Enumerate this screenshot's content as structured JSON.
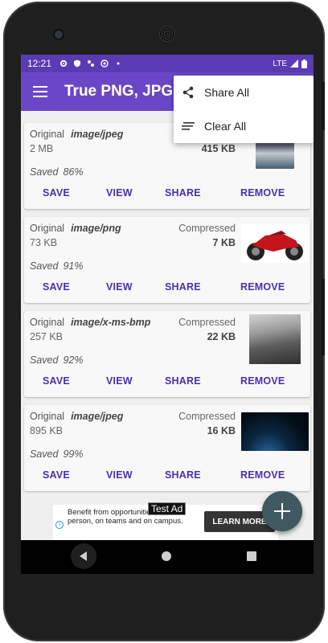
{
  "status_bar": {
    "time": "12:21",
    "network": "LTE"
  },
  "app_bar": {
    "title": "True PNG, JPG, ",
    "menu_icon": "hamburger-icon"
  },
  "overflow_menu": {
    "items": [
      {
        "label": "Share All",
        "icon": "share-icon"
      },
      {
        "label": "Clear All",
        "icon": "sort-lines-icon"
      }
    ]
  },
  "cards": [
    {
      "original_label": "Original",
      "mime": "image/jpeg",
      "original_size": "2 MB",
      "compressed_label": "",
      "compressed_size": "415 KB",
      "saved_label": "Saved",
      "saved_pct": "86%",
      "thumb": "office-photo",
      "actions": [
        "SAVE",
        "VIEW",
        "SHARE",
        "REMOVE"
      ]
    },
    {
      "original_label": "Original",
      "mime": "image/png",
      "original_size": "73 KB",
      "compressed_label": "Compressed",
      "compressed_size": "7 KB",
      "saved_label": "Saved",
      "saved_pct": "91%",
      "thumb": "motorbike-photo",
      "actions": [
        "SAVE",
        "VIEW",
        "SHARE",
        "REMOVE"
      ]
    },
    {
      "original_label": "Original",
      "mime": "image/x-ms-bmp",
      "original_size": "257 KB",
      "compressed_label": "Compressed",
      "compressed_size": "22 KB",
      "saved_label": "Saved",
      "saved_pct": "92%",
      "thumb": "village-photo",
      "actions": [
        "SAVE",
        "VIEW",
        "SHARE",
        "REMOVE"
      ]
    },
    {
      "original_label": "Original",
      "mime": "image/jpeg",
      "original_size": "895 KB",
      "compressed_label": "Compressed",
      "compressed_size": "16 KB",
      "saved_label": "Saved",
      "saved_pct": "99%",
      "thumb": "space-photo",
      "actions": [
        "SAVE",
        "VIEW",
        "SHARE",
        "REMOVE"
      ]
    }
  ],
  "ad": {
    "text": "Benefit from opportunities in person, on teams and on campus.",
    "tag": "Test Ad",
    "button": "LEARN MORE"
  },
  "fab": {
    "icon": "plus-icon"
  },
  "colors": {
    "primary": "#6b47c8",
    "status_bar": "#5b3bb3",
    "action_text": "#4a2fb0",
    "fab": "#3e5962"
  }
}
